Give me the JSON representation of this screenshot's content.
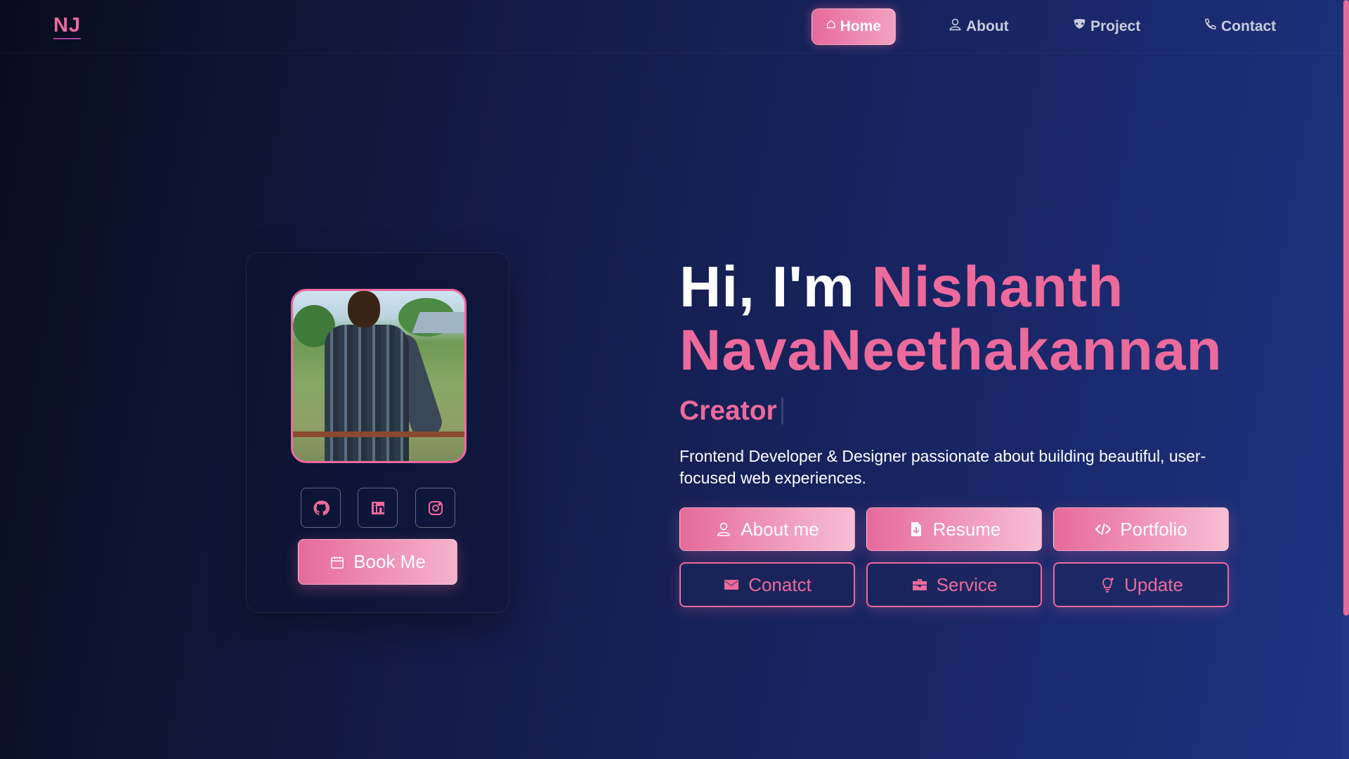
{
  "nav": {
    "logo": "NJ",
    "items": [
      {
        "label": "Home",
        "icon": "home-icon",
        "active": true
      },
      {
        "label": "About",
        "icon": "user-icon",
        "active": false
      },
      {
        "label": "Project",
        "icon": "mask-icon",
        "active": false
      },
      {
        "label": "Contact",
        "icon": "phone-icon",
        "active": false
      }
    ]
  },
  "profile": {
    "photo_alt": "Profile photo",
    "book_label": "Book Me",
    "socials": [
      {
        "name": "github-icon"
      },
      {
        "name": "linkedin-icon"
      },
      {
        "name": "instagram-icon"
      }
    ]
  },
  "hero": {
    "greeting": "Hi, I'm ",
    "name_first": "Nishanth",
    "name_last": "NavaNeethakannan",
    "role": "Creator",
    "description": "Frontend Developer & Designer passionate about building beautiful, user-focused web experiences."
  },
  "buttons": {
    "about": "About me",
    "resume": "Resume",
    "portfolio": "Portfolio",
    "contact": "Conatct",
    "service": "Service",
    "update": "Update"
  },
  "colors": {
    "accent": "#ec6a9c",
    "bg_dark": "#080c1c",
    "bg_blue": "#1e3383"
  }
}
